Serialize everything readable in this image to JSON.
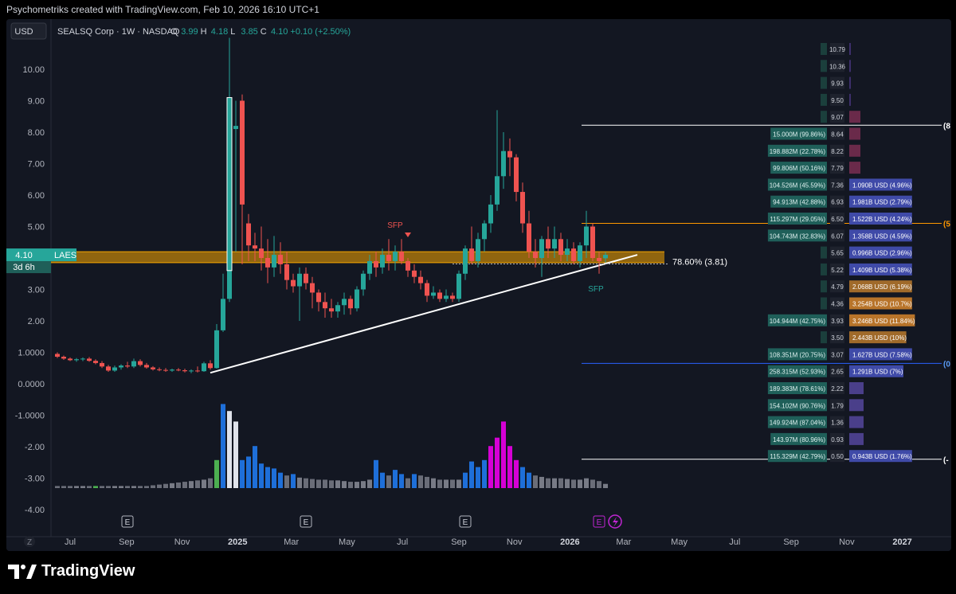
{
  "header": {
    "attribution": "Psychometriks created with TradingView.com, Feb 10, 2026 16:10 UTC+1"
  },
  "toolbar": {
    "currency": "USD"
  },
  "symbol_info": {
    "name": "SEALSQ Corp · 1W · NASDAQ",
    "o_label": "O",
    "o_value": "3.99",
    "h_label": "H",
    "h_value": "4.18",
    "l_label": "L",
    "l_value": "3.85",
    "c_label": "C",
    "c_value": "4.10",
    "change": "+0.10 (+2.50%)"
  },
  "price_tag": {
    "price": "4.10",
    "ticker": "LAES",
    "countdown": "3d 6h"
  },
  "footer": {
    "brand": "TradingView"
  },
  "annotations": {
    "sfp_top": "SFP",
    "sfp_bottom": "SFP",
    "fib_label": "78.60% (3.81)",
    "fib_right_labels": [
      "(8",
      "(5",
      "(0",
      "(-"
    ],
    "earnings_marker": "E",
    "event_marker": "E",
    "timezone_button": "Z"
  },
  "colors": {
    "background": "#131722",
    "up": "#26a69a",
    "down": "#ef5350",
    "zone_fill": "#f7a600",
    "volume_blue": "#1e6fd9",
    "volume_grey": "#787b86",
    "volume_magenta": "#d500d5",
    "volume_green": "#4caf50",
    "accent_purple": "#c026d3"
  },
  "chart_data": [
    {
      "type": "candlestick",
      "title": "SEALSQ Corp · 1W · NASDAQ",
      "ylim": [
        -4.6,
        11.0
      ],
      "y_ticks": [
        "10.00",
        "9.00",
        "8.00",
        "7.00",
        "6.00",
        "5.00",
        "3.00",
        "2.00",
        "1.0000",
        "0.0000",
        "-1.0000",
        "-2.00",
        "-3.00",
        "-4.00"
      ],
      "x_ticks": [
        "Jul",
        "Sep",
        "Nov",
        "2025",
        "Mar",
        "May",
        "Jul",
        "Sep",
        "Nov",
        "2026",
        "Mar",
        "May",
        "Jul",
        "Sep",
        "Nov",
        "2027"
      ],
      "x_range": [
        "2024-06-10",
        "2027-02-01"
      ],
      "candles_weekly_ohlc_start": "2024-06-17",
      "ohlc": [
        [
          0.95,
          1.0,
          0.82,
          0.86
        ],
        [
          0.86,
          0.9,
          0.76,
          0.8
        ],
        [
          0.8,
          0.84,
          0.72,
          0.75
        ],
        [
          0.75,
          0.82,
          0.7,
          0.78
        ],
        [
          0.78,
          0.84,
          0.72,
          0.8
        ],
        [
          0.8,
          0.85,
          0.7,
          0.73
        ],
        [
          0.73,
          0.78,
          0.62,
          0.66
        ],
        [
          0.66,
          0.72,
          0.5,
          0.55
        ],
        [
          0.55,
          0.6,
          0.38,
          0.42
        ],
        [
          0.42,
          0.58,
          0.38,
          0.52
        ],
        [
          0.52,
          0.62,
          0.45,
          0.58
        ],
        [
          0.58,
          0.7,
          0.5,
          0.55
        ],
        [
          0.55,
          0.8,
          0.5,
          0.72
        ],
        [
          0.72,
          0.78,
          0.55,
          0.6
        ],
        [
          0.6,
          0.66,
          0.48,
          0.52
        ],
        [
          0.52,
          0.56,
          0.42,
          0.46
        ],
        [
          0.46,
          0.52,
          0.4,
          0.44
        ],
        [
          0.44,
          0.5,
          0.38,
          0.42
        ],
        [
          0.42,
          0.48,
          0.38,
          0.45
        ],
        [
          0.45,
          0.5,
          0.4,
          0.43
        ],
        [
          0.43,
          0.48,
          0.36,
          0.4
        ],
        [
          0.4,
          0.46,
          0.34,
          0.42
        ],
        [
          0.42,
          0.55,
          0.36,
          0.4
        ],
        [
          0.4,
          0.7,
          0.38,
          0.65
        ],
        [
          0.65,
          0.75,
          0.45,
          0.5
        ],
        [
          0.5,
          1.9,
          0.48,
          1.7
        ],
        [
          1.7,
          3.5,
          1.65,
          2.7
        ],
        [
          2.7,
          11.0,
          2.6,
          9.1
        ],
        [
          8.1,
          9.0,
          4.2,
          8.2
        ],
        [
          9.0,
          9.2,
          3.8,
          5.7
        ],
        [
          5.1,
          5.4,
          3.9,
          4.4
        ],
        [
          4.4,
          4.8,
          3.9,
          4.3
        ],
        [
          4.3,
          5.0,
          3.6,
          4.0
        ],
        [
          4.0,
          4.6,
          3.2,
          3.7
        ],
        [
          3.7,
          4.7,
          3.4,
          4.1
        ],
        [
          4.1,
          4.5,
          3.5,
          3.8
        ],
        [
          3.8,
          4.2,
          3.0,
          3.3
        ],
        [
          3.3,
          3.5,
          2.9,
          3.1
        ],
        [
          3.1,
          3.7,
          2.0,
          3.5
        ],
        [
          3.5,
          3.7,
          3.0,
          3.2
        ],
        [
          3.2,
          3.4,
          2.4,
          2.9
        ],
        [
          2.9,
          3.0,
          2.3,
          2.6
        ],
        [
          2.6,
          2.9,
          2.1,
          2.4
        ],
        [
          2.4,
          2.7,
          2.1,
          2.3
        ],
        [
          2.3,
          2.6,
          2.1,
          2.5
        ],
        [
          2.5,
          2.9,
          2.2,
          2.7
        ],
        [
          2.7,
          2.8,
          2.2,
          2.4
        ],
        [
          2.4,
          3.1,
          2.3,
          3.0
        ],
        [
          3.0,
          3.6,
          2.8,
          3.5
        ],
        [
          3.5,
          4.1,
          3.3,
          3.9
        ],
        [
          3.9,
          4.2,
          3.4,
          3.7
        ],
        [
          3.7,
          4.3,
          3.5,
          4.1
        ],
        [
          4.1,
          4.6,
          3.6,
          3.9
        ],
        [
          3.9,
          4.4,
          3.6,
          4.2
        ],
        [
          4.2,
          4.6,
          3.8,
          3.9
        ],
        [
          3.9,
          4.0,
          3.4,
          3.6
        ],
        [
          3.6,
          3.8,
          3.2,
          3.4
        ],
        [
          3.4,
          3.6,
          3.0,
          3.2
        ],
        [
          3.2,
          3.3,
          2.6,
          2.8
        ],
        [
          2.8,
          3.1,
          2.7,
          2.9
        ],
        [
          2.9,
          3.0,
          2.6,
          2.7
        ],
        [
          2.7,
          3.0,
          2.6,
          2.8
        ],
        [
          2.8,
          2.9,
          2.6,
          2.7
        ],
        [
          2.7,
          3.6,
          2.6,
          3.5
        ],
        [
          3.5,
          4.4,
          3.3,
          4.3
        ],
        [
          4.3,
          5.0,
          3.8,
          3.9
        ],
        [
          3.9,
          4.8,
          3.7,
          4.6
        ],
        [
          4.6,
          5.2,
          4.2,
          5.1
        ],
        [
          5.1,
          6.0,
          4.8,
          5.7
        ],
        [
          5.7,
          8.7,
          5.5,
          6.6
        ],
        [
          6.6,
          8.0,
          6.2,
          7.4
        ],
        [
          7.4,
          7.8,
          6.6,
          7.2
        ],
        [
          7.2,
          7.3,
          5.8,
          6.1
        ],
        [
          6.1,
          6.4,
          4.8,
          5.1
        ],
        [
          5.1,
          5.5,
          4.0,
          4.2
        ],
        [
          4.2,
          4.6,
          3.7,
          4.0
        ],
        [
          4.0,
          4.7,
          3.4,
          4.6
        ],
        [
          4.6,
          5.0,
          4.0,
          4.3
        ],
        [
          4.3,
          5.0,
          4.0,
          4.6
        ],
        [
          4.6,
          4.8,
          3.9,
          4.1
        ],
        [
          4.1,
          4.6,
          3.9,
          4.3
        ],
        [
          4.3,
          4.5,
          3.8,
          3.9
        ],
        [
          3.9,
          4.5,
          3.7,
          4.4
        ],
        [
          4.4,
          5.5,
          4.0,
          5.0
        ],
        [
          5.0,
          5.1,
          3.9,
          4.0
        ],
        [
          4.0,
          4.2,
          3.5,
          3.9
        ],
        [
          3.99,
          4.18,
          3.85,
          4.1
        ]
      ],
      "volume_weeks_note": "relative volume bars per candle",
      "volume": [
        3,
        3,
        3,
        3,
        3,
        3,
        3,
        3,
        3,
        3,
        3,
        3,
        3,
        3,
        3,
        4,
        5,
        6,
        7,
        8,
        9,
        10,
        11,
        12,
        14,
        40,
        120,
        110,
        95,
        40,
        45,
        60,
        35,
        30,
        28,
        22,
        18,
        20,
        15,
        14,
        13,
        12,
        12,
        11,
        11,
        10,
        9,
        9,
        10,
        12,
        40,
        22,
        18,
        26,
        20,
        14,
        20,
        18,
        16,
        14,
        12,
        12,
        12,
        12,
        22,
        38,
        30,
        40,
        60,
        72,
        95,
        60,
        40,
        30,
        22,
        18,
        16,
        14,
        14,
        14,
        13,
        12,
        12,
        14,
        12,
        10,
        6
      ],
      "volume_colors_index": {
        "green": [
          6,
          25
        ],
        "white": [
          27,
          28
        ],
        "magenta": [
          68,
          69,
          70,
          71,
          72
        ]
      },
      "horizontal_zone": {
        "from": 3.85,
        "to": 4.2,
        "label": "LAES"
      },
      "fib_levels": [
        {
          "value": 8.22,
          "label": "(8"
        },
        {
          "value": 5.1,
          "label": "(5"
        },
        {
          "value": 0.65,
          "label": "(0"
        },
        {
          "value": -2.4,
          "label": "(-"
        }
      ],
      "trendline": {
        "from": [
          "2024-12-02",
          0.35
        ],
        "to": [
          "2026-03-16",
          4.1
        ],
        "label": "78.60% (3.81)"
      },
      "sfp_markers": [
        {
          "label": "SFP",
          "date": "2025-06-16",
          "price": 5.0
        },
        {
          "label": "SFP",
          "date": "2026-01-12",
          "price": 3.2
        }
      ],
      "earnings_markers_dates": [
        "2024-09-02",
        "2025-03-17",
        "2025-09-08",
        "2026-02-02"
      ]
    },
    {
      "type": "table",
      "title": "Volume profile",
      "price_levels": [
        "10.79",
        "10.36",
        "9.93",
        "9.50",
        "9.07",
        "8.64",
        "8.22",
        "7.79",
        "7.36",
        "6.93",
        "6.50",
        "6.07",
        "5.65",
        "5.22",
        "4.79",
        "4.36",
        "3.93",
        "3.50",
        "3.07",
        "2.65",
        "2.22",
        "1.79",
        "1.36",
        "0.93",
        "0.50"
      ],
      "left_values": [
        "",
        "",
        "",
        "",
        "",
        "15.000M (99.86%)",
        "198.882M (22.78%)",
        "99.806M (50.16%)",
        "104.526M (45.59%)",
        "94.913M (42.88%)",
        "115.297M (29.05%)",
        "104.743M (32.83%)",
        "",
        "",
        "",
        "",
        "104.944M (42.75%)",
        "",
        "108.351M (20.75%)",
        "258.315M (52.93%)",
        "189.383M (78.61%)",
        "154.102M (90.76%)",
        "149.924M (87.04%)",
        "143.97M (80.96%)",
        "115.329M (42.79%)"
      ],
      "right_values": [
        "",
        "",
        "",
        "",
        "",
        "",
        "",
        "",
        "1.090B USD (4.96%)",
        "1.981B USD (2.79%)",
        "1.522B USD (4.24%)",
        "1.358B USD (4.59%)",
        "0.996B USD (2.96%)",
        "1.409B USD (5.38%)",
        "2.068B USD (6.19%)",
        "3.254B USD (10.7%)",
        "3.246B USD (11.84%)",
        "2.443B USD (10%)",
        "1.627B USD (7.58%)",
        "1.291B USD (7%)",
        "",
        "",
        "",
        "",
        "0.943B USD (1.76%)"
      ]
    }
  ]
}
